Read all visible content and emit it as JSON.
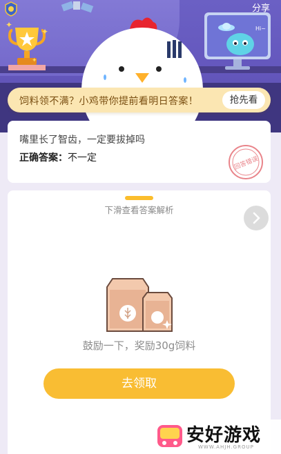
{
  "header": {
    "share_label": "分享",
    "icons": [
      "badge-icon",
      "trophy-icon",
      "satellite-icon",
      "alien-monitor-icon",
      "chicken-mascot"
    ]
  },
  "promo": {
    "text": "饲料领不满？小鸡带你提前看明日答案！",
    "button_label": "抢先看"
  },
  "question": {
    "text": "嘴里长了智齿，一定要拔掉吗",
    "answer_label": "正确答案：",
    "answer_value": "不一定",
    "stamp_text": "回答错误"
  },
  "reward": {
    "swipe_hint": "下滑查看答案解析",
    "reward_text": "鼓励一下，奖励30g饲料",
    "claim_button": "去领取"
  },
  "watermark": {
    "title": "安好游戏",
    "subtitle": "WWW.AHJH.GROUP"
  },
  "colors": {
    "hero_bg": "#6b60c4",
    "promo_bg": "#fbe6b2",
    "accent_yellow": "#f9bd33",
    "stamp_red": "#e9848a"
  }
}
